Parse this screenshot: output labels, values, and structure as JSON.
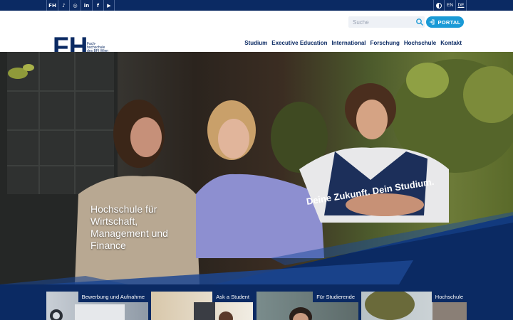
{
  "topbar": {
    "social": [
      {
        "icon": "fh-icon",
        "glyph": "FH"
      },
      {
        "icon": "tiktok-icon",
        "glyph": "♪"
      },
      {
        "icon": "instagram-icon",
        "glyph": "◎"
      },
      {
        "icon": "linkedin-icon",
        "glyph": "in"
      },
      {
        "icon": "facebook-icon",
        "glyph": "f"
      },
      {
        "icon": "youtube-icon",
        "glyph": "▶"
      }
    ],
    "languages": [
      "EN",
      "DE"
    ],
    "active_language": "DE"
  },
  "header": {
    "logo_text": "FH",
    "logo_subtext": [
      "Fach-",
      "hochschule",
      "des BFI Wien"
    ],
    "search_placeholder": "Suche",
    "portal_label": "PORTAL",
    "nav": [
      "Studium",
      "Executive Education",
      "International",
      "Forschung",
      "Hochschule",
      "Kontakt"
    ]
  },
  "hero": {
    "headline": "Hochschule für Wirtschaft, Management und Finance",
    "slogan": "Deine Zukunft. Dein Studium."
  },
  "cards": [
    {
      "label": "Bewerbung und Aufnahme"
    },
    {
      "label": "Ask a Student"
    },
    {
      "label": "Für Studierende"
    },
    {
      "label": "Hochschule"
    }
  ],
  "colors": {
    "navy": "#0b2a63",
    "accent_blue": "#1a9ad6"
  }
}
